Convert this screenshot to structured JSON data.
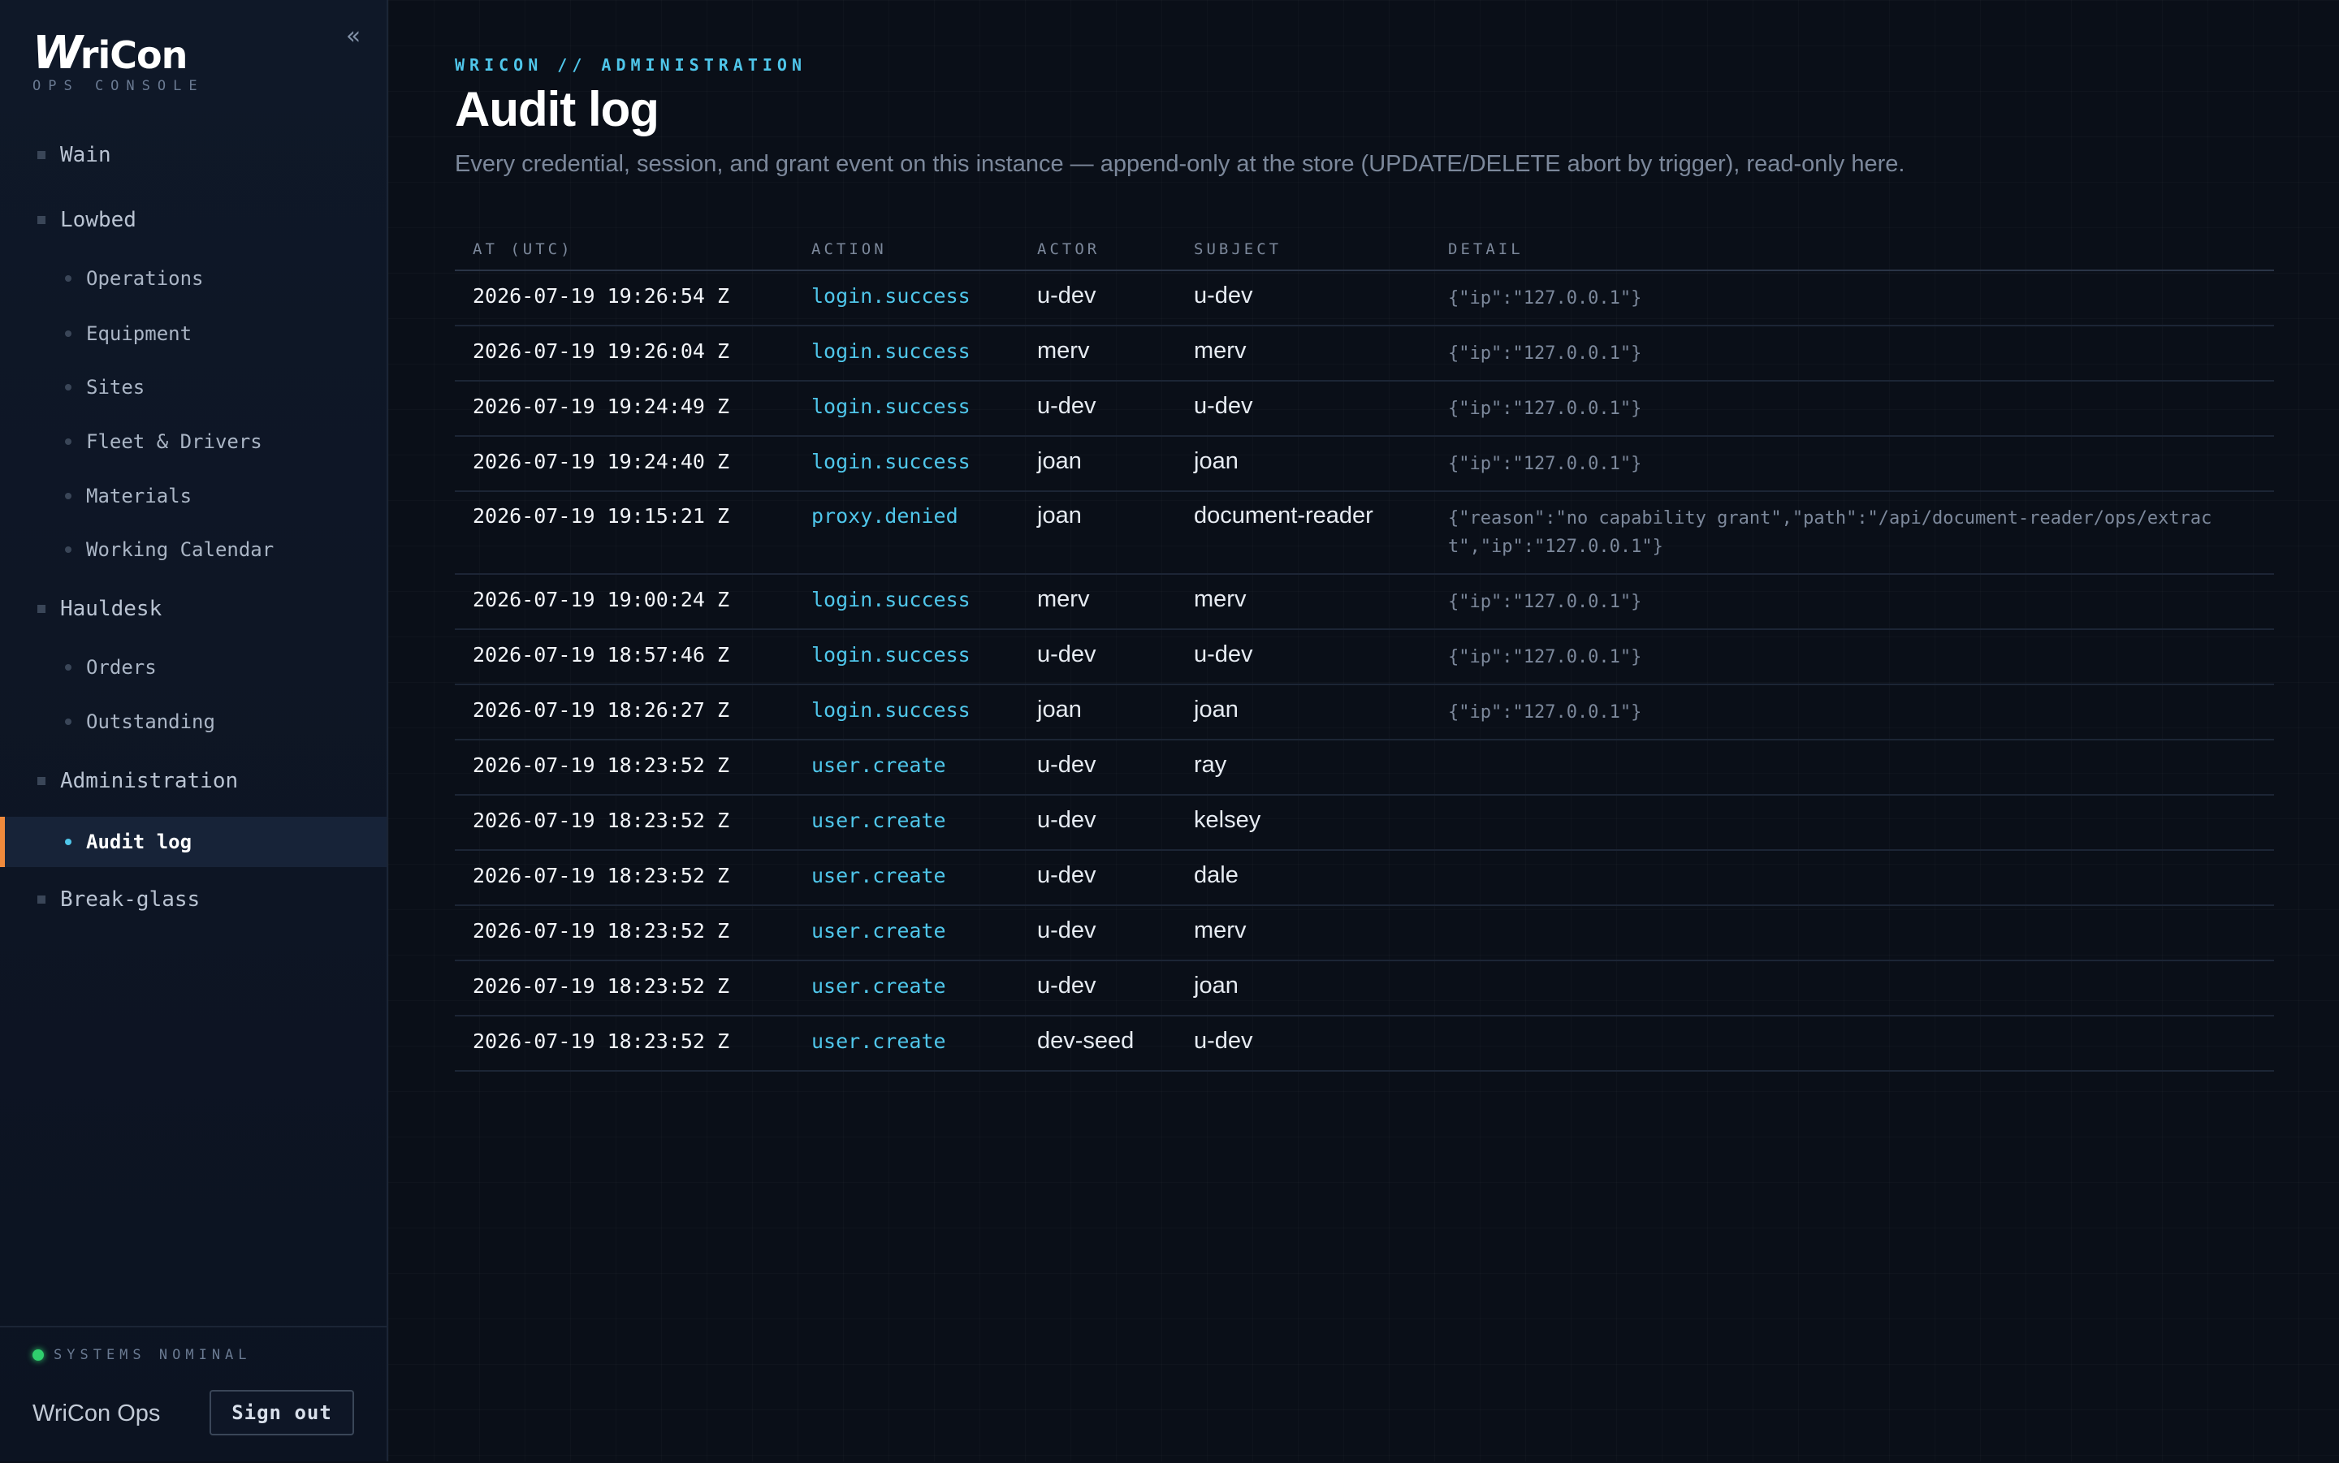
{
  "brand": {
    "logo_w": "W",
    "logo_rest": "riCon",
    "subtitle": "OPS CONSOLE",
    "collapse_glyph": "«"
  },
  "sidebar": {
    "items": [
      {
        "label": "Wain",
        "level": "top"
      },
      {
        "label": "Lowbed",
        "level": "top"
      },
      {
        "label": "Operations",
        "level": "sub"
      },
      {
        "label": "Equipment",
        "level": "sub"
      },
      {
        "label": "Sites",
        "level": "sub"
      },
      {
        "label": "Fleet & Drivers",
        "level": "sub"
      },
      {
        "label": "Materials",
        "level": "sub"
      },
      {
        "label": "Working Calendar",
        "level": "sub"
      },
      {
        "label": "Hauldesk",
        "level": "top"
      },
      {
        "label": "Orders",
        "level": "sub"
      },
      {
        "label": "Outstanding",
        "level": "sub"
      },
      {
        "label": "Administration",
        "level": "top"
      },
      {
        "label": "Audit log",
        "level": "sub",
        "active": true
      },
      {
        "label": "Break-glass",
        "level": "top"
      }
    ],
    "status": "SYSTEMS NOMINAL",
    "org": "WriCon Ops",
    "signout_label": "Sign out"
  },
  "colors": {
    "accent": "#4fc6ea",
    "active_marker": "#f08a3c",
    "status_ok": "#2fcf6d"
  },
  "main": {
    "breadcrumb": "WRICON // ADMINISTRATION",
    "title": "Audit log",
    "description": "Every credential, session, and grant event on this instance — append-only at the store (UPDATE/DELETE abort by trigger), read-only here."
  },
  "table": {
    "headers": {
      "at": "AT (UTC)",
      "action": "ACTION",
      "actor": "ACTOR",
      "subject": "SUBJECT",
      "detail": "DETAIL"
    },
    "rows": [
      {
        "at": "2026-07-19 19:26:54 Z",
        "action": "login.success",
        "actor": "u-dev",
        "subject": "u-dev",
        "detail": "{\"ip\":\"127.0.0.1\"}"
      },
      {
        "at": "2026-07-19 19:26:04 Z",
        "action": "login.success",
        "actor": "merv",
        "subject": "merv",
        "detail": "{\"ip\":\"127.0.0.1\"}"
      },
      {
        "at": "2026-07-19 19:24:49 Z",
        "action": "login.success",
        "actor": "u-dev",
        "subject": "u-dev",
        "detail": "{\"ip\":\"127.0.0.1\"}"
      },
      {
        "at": "2026-07-19 19:24:40 Z",
        "action": "login.success",
        "actor": "joan",
        "subject": "joan",
        "detail": "{\"ip\":\"127.0.0.1\"}"
      },
      {
        "at": "2026-07-19 19:15:21 Z",
        "action": "proxy.denied",
        "actor": "joan",
        "subject": "document-reader",
        "detail": "{\"reason\":\"no capability grant\",\"path\":\"/api/document-reader/ops/extract\",\"ip\":\"127.0.0.1\"}"
      },
      {
        "at": "2026-07-19 19:00:24 Z",
        "action": "login.success",
        "actor": "merv",
        "subject": "merv",
        "detail": "{\"ip\":\"127.0.0.1\"}"
      },
      {
        "at": "2026-07-19 18:57:46 Z",
        "action": "login.success",
        "actor": "u-dev",
        "subject": "u-dev",
        "detail": "{\"ip\":\"127.0.0.1\"}"
      },
      {
        "at": "2026-07-19 18:26:27 Z",
        "action": "login.success",
        "actor": "joan",
        "subject": "joan",
        "detail": "{\"ip\":\"127.0.0.1\"}"
      },
      {
        "at": "2026-07-19 18:23:52 Z",
        "action": "user.create",
        "actor": "u-dev",
        "subject": "ray",
        "detail": ""
      },
      {
        "at": "2026-07-19 18:23:52 Z",
        "action": "user.create",
        "actor": "u-dev",
        "subject": "kelsey",
        "detail": ""
      },
      {
        "at": "2026-07-19 18:23:52 Z",
        "action": "user.create",
        "actor": "u-dev",
        "subject": "dale",
        "detail": ""
      },
      {
        "at": "2026-07-19 18:23:52 Z",
        "action": "user.create",
        "actor": "u-dev",
        "subject": "merv",
        "detail": ""
      },
      {
        "at": "2026-07-19 18:23:52 Z",
        "action": "user.create",
        "actor": "u-dev",
        "subject": "joan",
        "detail": ""
      },
      {
        "at": "2026-07-19 18:23:52 Z",
        "action": "user.create",
        "actor": "dev-seed",
        "subject": "u-dev",
        "detail": ""
      }
    ]
  }
}
